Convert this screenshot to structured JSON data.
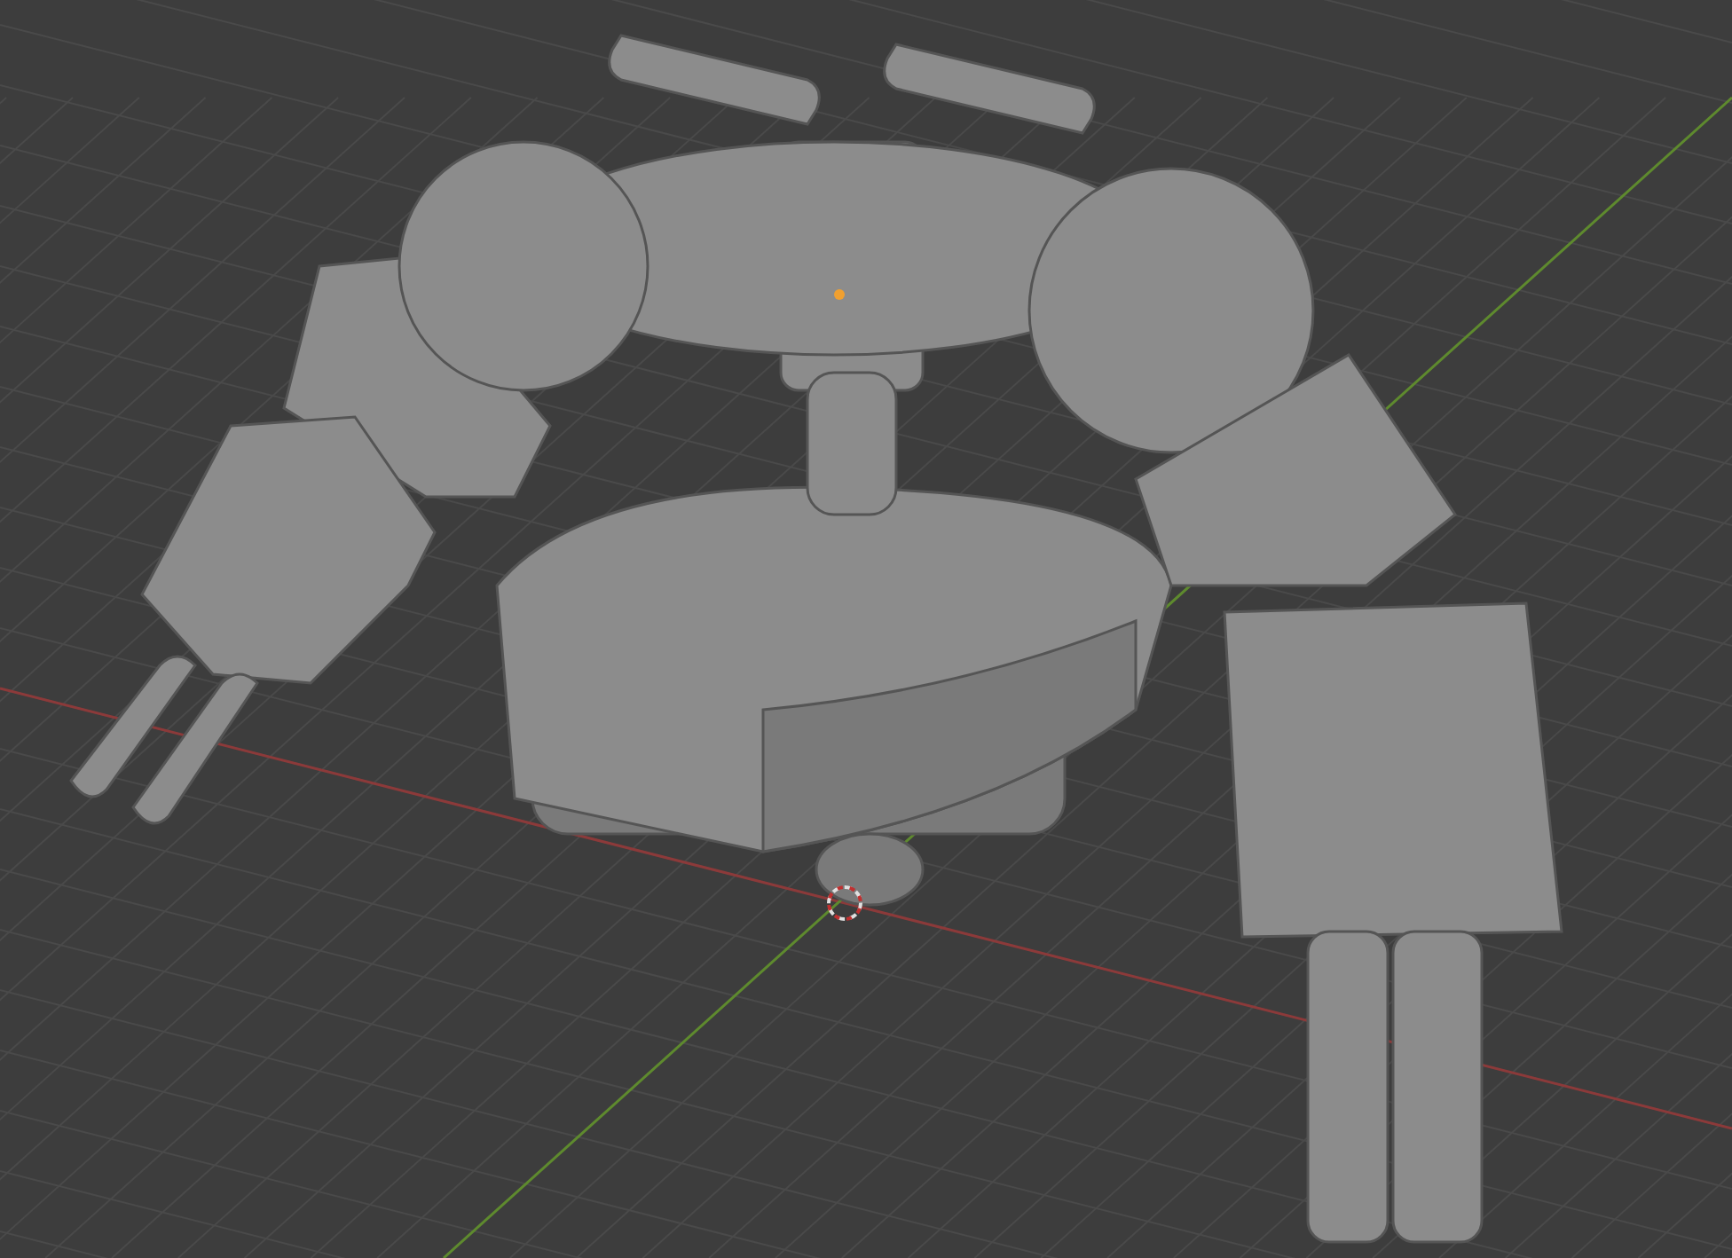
{
  "viewport": {
    "axes": [
      {
        "kind": "x",
        "color": "#8c3a3a"
      },
      {
        "kind": "y",
        "color": "#5e8a2e"
      }
    ]
  }
}
